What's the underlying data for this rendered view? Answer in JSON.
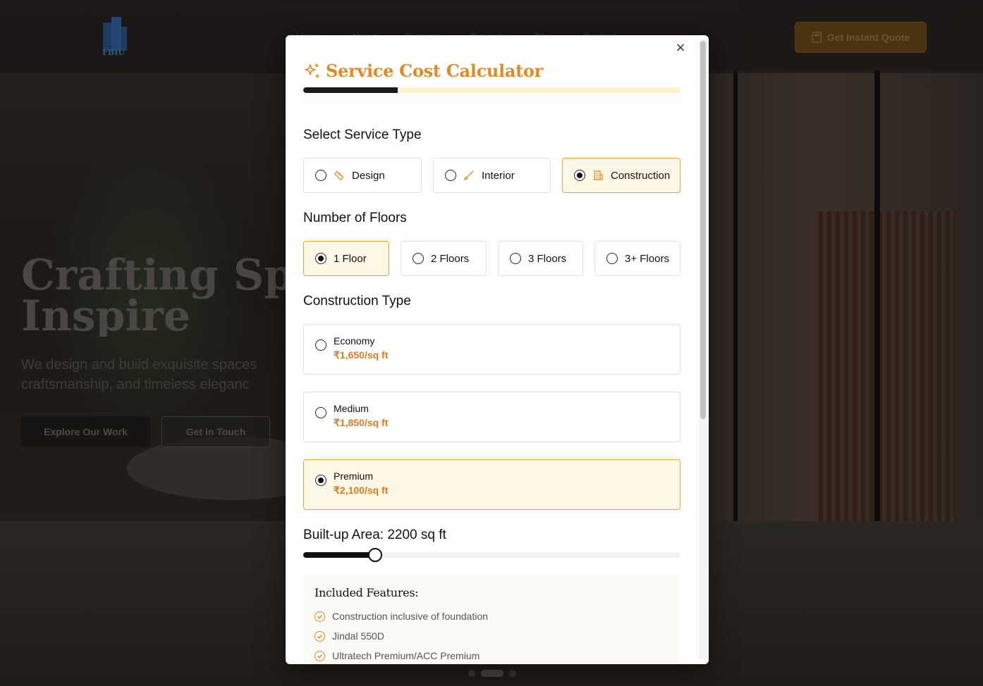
{
  "background_page": {
    "logo_text": "FBIU",
    "nav": [
      "Home",
      "About",
      "Services",
      "Projects",
      "Blog",
      "Contact"
    ],
    "quote_button": "Get Instant Quote",
    "hero_title_line1": "Crafting Space",
    "hero_title_line2": "Inspire",
    "hero_sub_line1": "We design and build exquisite spaces",
    "hero_sub_line2": "craftsmanship, and timeless eleganc",
    "explore_button": "Explore Our Work",
    "contact_button": "Get in Touch"
  },
  "modal": {
    "title": "Service Cost Calculator",
    "close_symbol": "×",
    "progress_fraction": 0.25,
    "service_type": {
      "label": "Select Service Type",
      "options": [
        {
          "label": "Design",
          "icon": "ruler-icon",
          "selected": false
        },
        {
          "label": "Interior",
          "icon": "brush-icon",
          "selected": false
        },
        {
          "label": "Construction",
          "icon": "building-icon",
          "selected": true
        }
      ]
    },
    "floors": {
      "label": "Number of Floors",
      "options": [
        {
          "label": "1 Floor",
          "selected": true
        },
        {
          "label": "2 Floors",
          "selected": false
        },
        {
          "label": "3 Floors",
          "selected": false
        },
        {
          "label": "3+ Floors",
          "selected": false
        }
      ]
    },
    "construction_type": {
      "label": "Construction Type",
      "options": [
        {
          "name": "Economy",
          "price": "₹1,650/sq ft",
          "selected": false
        },
        {
          "name": "Medium",
          "price": "₹1,850/sq ft",
          "selected": false
        },
        {
          "name": "Premium",
          "price": "₹2,100/sq ft",
          "selected": true
        }
      ]
    },
    "area": {
      "label": "Built-up Area: 2200 sq ft",
      "value": 2200,
      "slider_fraction": 0.19
    },
    "features": {
      "title": "Included Features:",
      "items": [
        "Construction inclusive of foundation",
        "Jindal 550D",
        "Ultratech Premium/ACC Premium"
      ]
    }
  },
  "colors": {
    "accent": "#e08a24",
    "price": "#dc7a1f",
    "selected_bg": "#fef7e6",
    "selected_border": "#e8a33d"
  }
}
